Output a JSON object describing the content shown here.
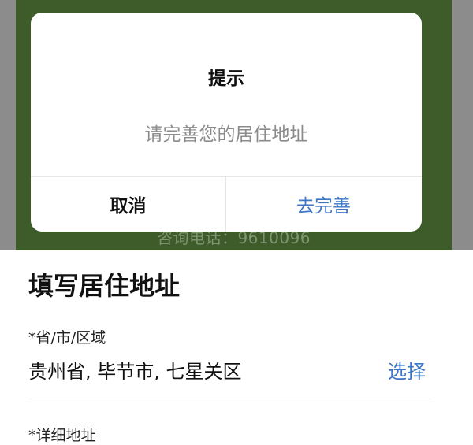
{
  "background": {
    "phone_text": "咨询电话：9610096"
  },
  "dialog": {
    "title": "提示",
    "message": "请完善您的居住地址",
    "cancel_label": "取消",
    "confirm_label": "去完善"
  },
  "form": {
    "title": "填写居住地址",
    "region_label": "*省/市/区域",
    "region_value": "贵州省, 毕节市, 七星关区",
    "select_label": "选择",
    "detail_label": "*详细地址"
  },
  "colors": {
    "accent": "#3d76c7",
    "overlay_green": "#3e5c2a"
  }
}
